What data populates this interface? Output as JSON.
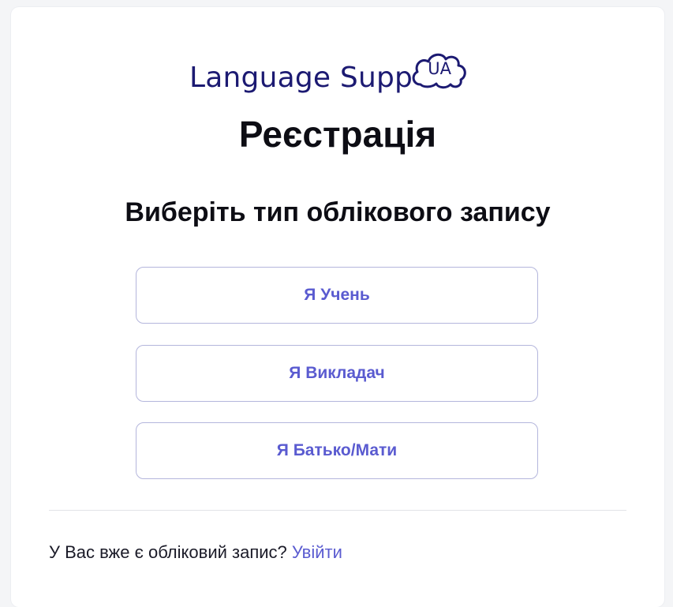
{
  "logo": {
    "text": "Language Supp",
    "badge": "UA"
  },
  "page": {
    "title": "Реєстрація",
    "subtitle": "Виберіть тип облікового запису"
  },
  "roles": [
    {
      "label": "Я Учень"
    },
    {
      "label": "Я Викладач"
    },
    {
      "label": "Я Батько/Мати"
    }
  ],
  "footer": {
    "prompt": "У Вас вже є обліковий запис?",
    "login_link": "Увійти"
  },
  "colors": {
    "brand": "#1c1a72",
    "accent": "#5a5bd0",
    "border": "#b4b6dc"
  }
}
